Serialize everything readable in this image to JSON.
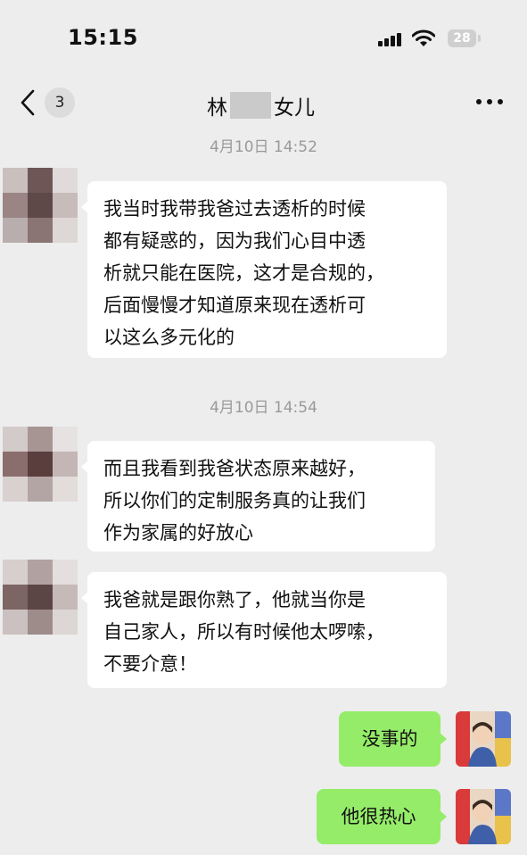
{
  "status_bar": {
    "time": "15:15",
    "battery": "28"
  },
  "nav": {
    "unread_count": "3",
    "title_prefix": "林",
    "title_suffix": "女儿",
    "back_icon": "chevron-left-icon",
    "more_icon": "more-dots-icon"
  },
  "messages": {
    "ts1": "4月10日 14:52",
    "msg1": {
      "lines": [
        "我当时我带我爸过去透析的时候",
        "都有疑惑的，因为我们心目中透",
        "析就只能在医院，这才是合规的，",
        "后面慢慢才知道原来现在透析可",
        "以这么多元化的"
      ]
    },
    "ts2": "4月10日 14:54",
    "msg2": {
      "lines": [
        "而且我看到我爸状态原来越好，",
        "所以你们的定制服务真的让我们",
        "作为家属的好放心"
      ]
    },
    "msg3": {
      "lines": [
        "我爸就是跟你熟了，他就当你是",
        "自己家人，所以有时候他太啰嗦，",
        "不要介意！"
      ]
    },
    "reply1": "没事的",
    "reply2": "他很热心"
  },
  "colors": {
    "background": "#ededed",
    "incoming_bubble": "#ffffff",
    "outgoing_bubble": "#95ec69"
  }
}
